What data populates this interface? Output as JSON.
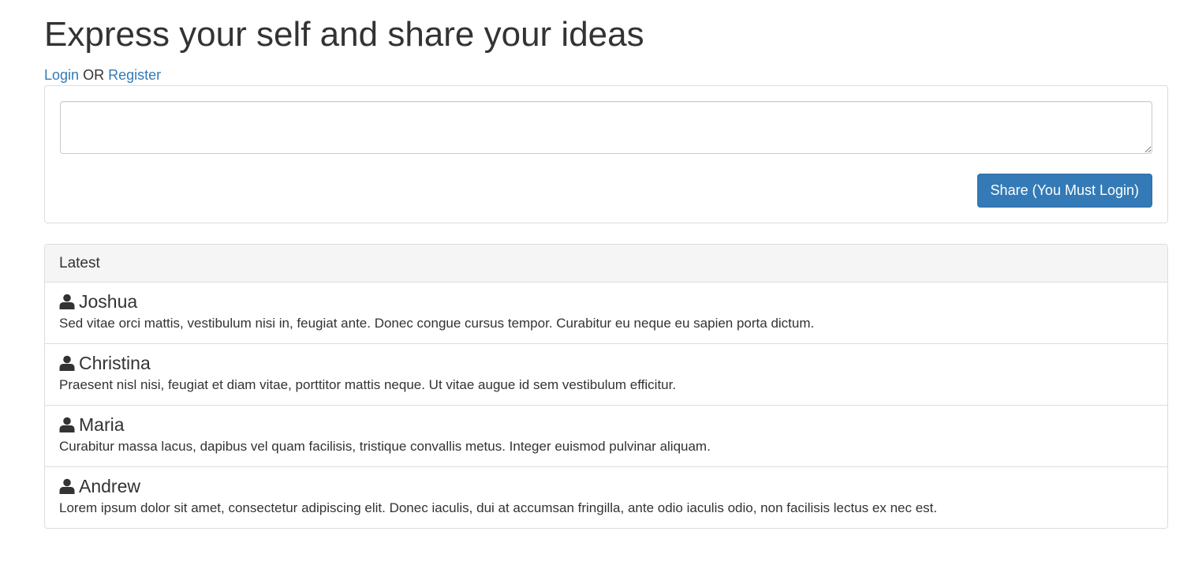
{
  "header": {
    "title": "Express your self and share your ideas"
  },
  "auth": {
    "login_label": "Login",
    "or_label": "OR",
    "register_label": "Register"
  },
  "share_form": {
    "textarea_value": "",
    "button_label": "Share (You Must Login)"
  },
  "latest": {
    "heading": "Latest",
    "posts": [
      {
        "author": "Joshua",
        "icon": "user-icon",
        "text": "Sed vitae orci mattis, vestibulum nisi in, feugiat ante. Donec congue cursus tempor. Curabitur eu neque eu sapien porta dictum."
      },
      {
        "author": "Christina",
        "icon": "user-icon",
        "text": "Praesent nisl nisi, feugiat et diam vitae, porttitor mattis neque. Ut vitae augue id sem vestibulum efficitur."
      },
      {
        "author": "Maria",
        "icon": "user-icon",
        "text": "Curabitur massa lacus, dapibus vel quam facilisis, tristique convallis metus. Integer euismod pulvinar aliquam."
      },
      {
        "author": "Andrew",
        "icon": "user-icon",
        "text": "Lorem ipsum dolor sit amet, consectetur adipiscing elit. Donec iaculis, dui at accumsan fringilla, ante odio iaculis odio, non facilisis lectus ex nec est."
      }
    ]
  },
  "colors": {
    "link": "#337ab7",
    "button_bg": "#337ab7",
    "text": "#333333",
    "panel_border": "#dddddd",
    "panel_heading_bg": "#f5f5f5"
  }
}
